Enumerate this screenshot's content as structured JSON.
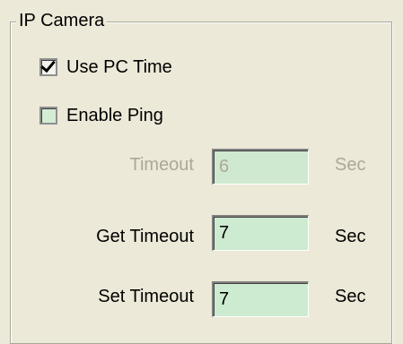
{
  "group": {
    "title": "IP Camera"
  },
  "use_pc_time": {
    "label": "Use PC Time",
    "checked": true
  },
  "enable_ping": {
    "label": "Enable Ping",
    "checked": false
  },
  "timeout": {
    "label": "Timeout",
    "value": "6",
    "unit": "Sec",
    "enabled": false
  },
  "get_timeout": {
    "label": "Get Timeout",
    "value": "7",
    "unit": "Sec"
  },
  "set_timeout": {
    "label": "Set Timeout",
    "value": "7",
    "unit": "Sec"
  },
  "colors": {
    "background": "#ece9d8",
    "field_background": "#cdebd0",
    "disabled_text": "#aca899"
  }
}
